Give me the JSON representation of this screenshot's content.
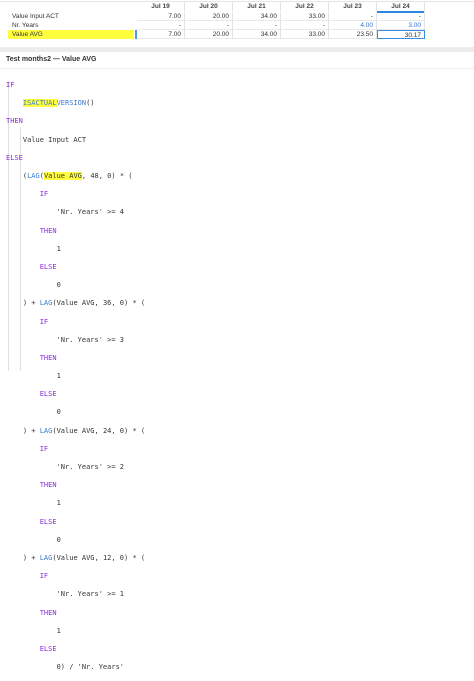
{
  "grid": {
    "columns": [
      "Jul 19",
      "Jul 20",
      "Jul 21",
      "Jul 22",
      "Jul 23",
      "Jul 24"
    ],
    "rows": [
      {
        "label": "Value Input ACT",
        "values": [
          "7.00",
          "20.00",
          "34.00",
          "33.00",
          "-",
          "-"
        ]
      },
      {
        "label": "Nr. Years",
        "values": [
          "-",
          "-",
          "-",
          "-",
          "4.00",
          "3.00"
        ]
      },
      {
        "label": "Value AVG",
        "values": [
          "7.00",
          "20.00",
          "34.00",
          "33.00",
          "23.50",
          "30.17"
        ]
      }
    ]
  },
  "panel": {
    "title": "Test months2 — Value AVG"
  },
  "code": {
    "kw_if": "IF",
    "kw_then": "THEN",
    "kw_else": "ELSE",
    "isactual_a": "ISACTUAL",
    "isactual_b": "VERSION",
    "isactual_end": "()",
    "value_input": "Value Input ACT",
    "lag": "LAG",
    "lag_value_avg": "Value AVG",
    "lag1_args": ", 48, 0) * (",
    "lag2_args": "(Value AVG, 36, 0) * (",
    "lag3_args": "(Value AVG, 24, 0) * (",
    "lag4_args": "(Value AVG, 12, 0) * (",
    "plus_prefix": ") + ",
    "cond_4": "'Nr. Years' >= 4",
    "cond_3": "'Nr. Years' >= 3",
    "cond_2": "'Nr. Years' >= 2",
    "cond_1": "'Nr. Years' >= 1",
    "one": "1",
    "zero": "0",
    "final": "0) / 'Nr. Years'"
  }
}
